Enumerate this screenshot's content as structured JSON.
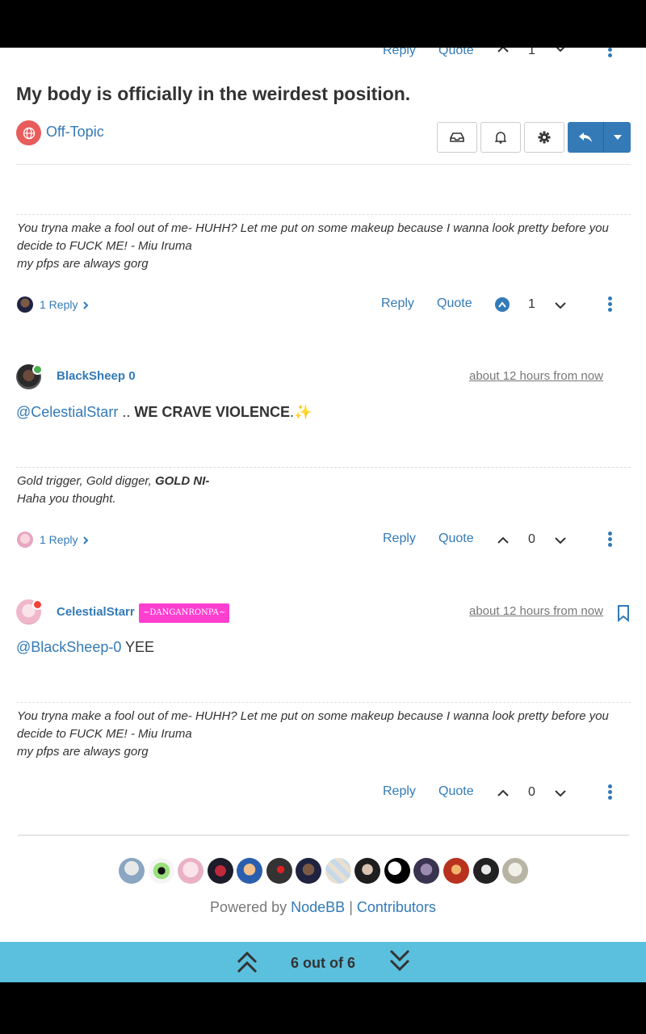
{
  "topic": {
    "title": "My body is officially in the weirdest position.",
    "category": "Off-Topic"
  },
  "top_actions": {
    "reply": "Reply",
    "quote": "Quote",
    "votes": "1"
  },
  "post1": {
    "signature_line1": "You tryna make a fool out of me- HUHH? Let me put on some makeup because I wanna look pretty before you decide to FUCK ME! - Miu Iruma",
    "signature_line2": "my pfps are always gorg",
    "replies": "1 Reply",
    "reply": "Reply",
    "quote": "Quote",
    "votes": "1"
  },
  "post2": {
    "author": "BlackSheep 0",
    "time": "about 12 hours from now",
    "mention": "@CelestialStarr",
    "sep": "..",
    "bold_text": "WE CRAVE VIOLENCE",
    "tail": ".",
    "sparkles": "✨",
    "signature_line1_prefix": "Gold trigger, Gold digger, ",
    "signature_line1_bold": "GOLD NI-",
    "signature_line2": "Haha you thought.",
    "replies": "1 Reply",
    "reply": "Reply",
    "quote": "Quote",
    "votes": "0"
  },
  "post3": {
    "author": "CelestialStarr",
    "badge": "~DANGANRONPA~",
    "time": "about 12 hours from now",
    "mention": "@BlackSheep-0",
    "text": "YEE",
    "signature_line1": "You tryna make a fool out of me- HUHH? Let me put on some makeup because I wanna look pretty before you decide to FUCK ME! - Miu Iruma",
    "signature_line2": "my pfps are always gorg",
    "reply": "Reply",
    "quote": "Quote",
    "votes": "0"
  },
  "footer": {
    "powered_by": "Powered by",
    "nodebb": "NodeBB",
    "pipe": "|",
    "contributors": "Contributors"
  },
  "pagination": {
    "label": "6 out of 6"
  },
  "colors": {
    "link": "#337ab7",
    "primary_button": "#337ab7",
    "category": "#e95c5c",
    "online": "#4caf50",
    "away": "#f44336",
    "badge": "#ff3fd0",
    "pagination_bar": "#5bc0de"
  }
}
